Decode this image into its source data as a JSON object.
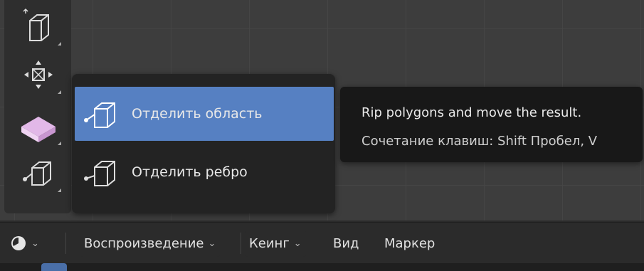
{
  "flyout": {
    "items": [
      {
        "label": "Отделить область",
        "icon": "rip-region-icon",
        "selected": true
      },
      {
        "label": "Отделить ребро",
        "icon": "rip-edge-icon",
        "selected": false
      }
    ]
  },
  "tooltip": {
    "description": "Rip polygons and move the result.",
    "shortcut": "Сочетание клавиш: Shift Пробел, V"
  },
  "timeline": {
    "playback": "Воспроизведение",
    "keying": "Кеинг",
    "view": "Вид",
    "marker": "Маркер"
  },
  "toolbar": {
    "tools": [
      "extrude-icon",
      "transform-icon",
      "rip-active-icon",
      "rip-edge-tool-icon"
    ]
  },
  "colors": {
    "selected": "#5680c2",
    "viewport": "#3d3d3d",
    "tooltip_bg": "#181818"
  }
}
